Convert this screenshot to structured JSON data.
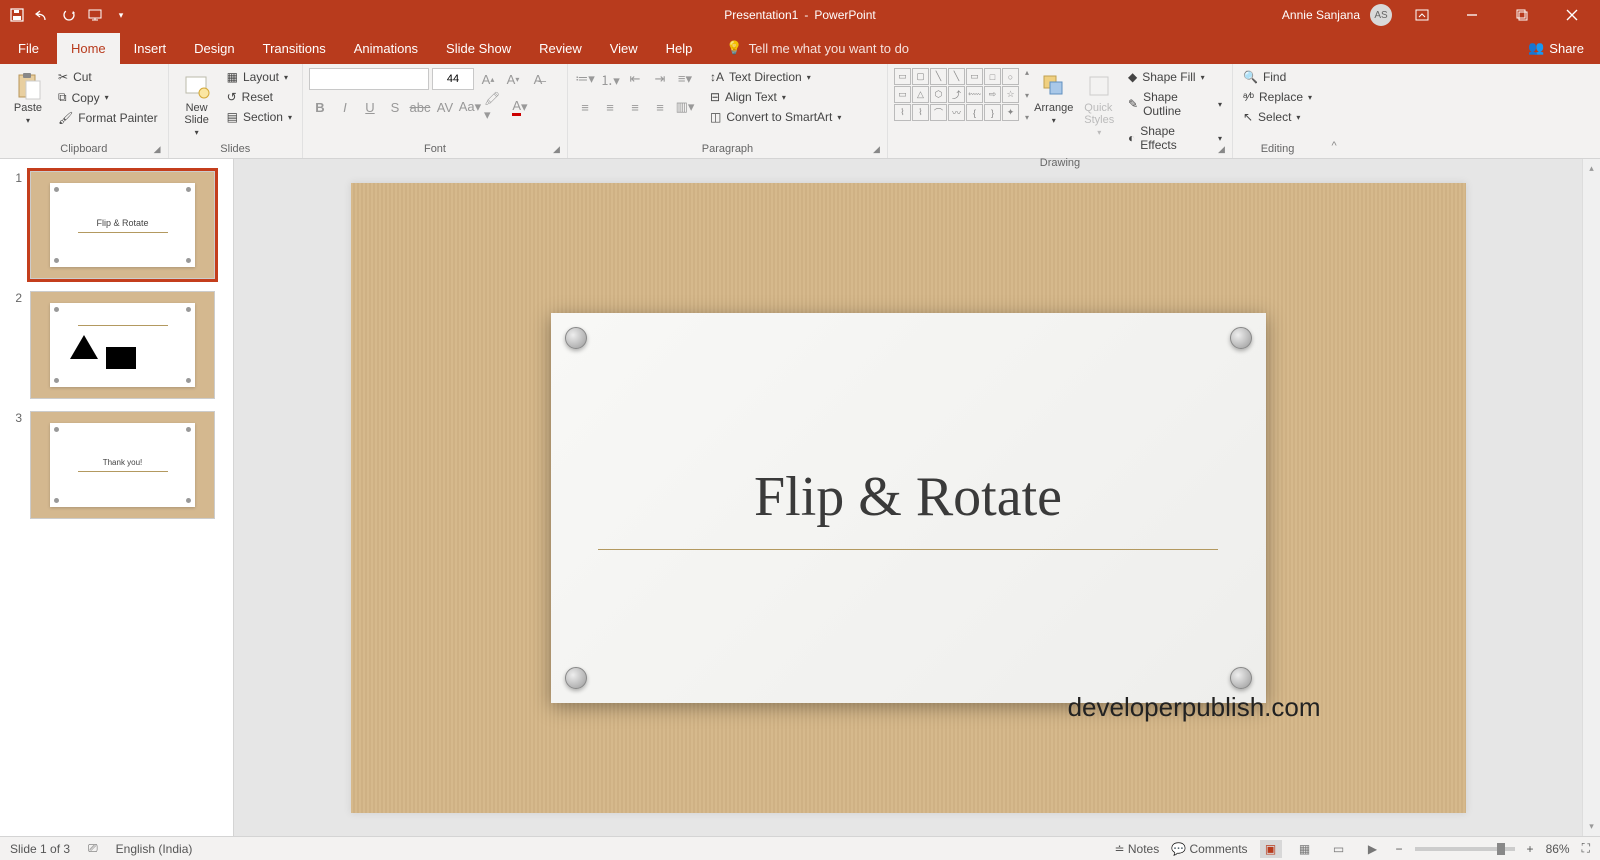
{
  "title": {
    "doc": "Presentation1",
    "app": "PowerPoint"
  },
  "user": {
    "name": "Annie Sanjana",
    "initials": "AS"
  },
  "qat": [
    "save-icon",
    "undo-icon",
    "redo-icon",
    "start-icon",
    "more-icon"
  ],
  "tabs": [
    "File",
    "Home",
    "Insert",
    "Design",
    "Transitions",
    "Animations",
    "Slide Show",
    "Review",
    "View",
    "Help"
  ],
  "active_tab": "Home",
  "tellme": "Tell me what you want to do",
  "share": "Share",
  "ribbon": {
    "clipboard": {
      "label": "Clipboard",
      "paste": "Paste",
      "cut": "Cut",
      "copy": "Copy",
      "format_painter": "Format Painter"
    },
    "slides": {
      "label": "Slides",
      "new_slide": "New\nSlide",
      "layout": "Layout",
      "reset": "Reset",
      "section": "Section"
    },
    "font": {
      "label": "Font",
      "name": "",
      "size": "44"
    },
    "paragraph": {
      "label": "Paragraph",
      "text_direction": "Text Direction",
      "align_text": "Align Text",
      "smartart": "Convert to SmartArt"
    },
    "drawing": {
      "label": "Drawing",
      "arrange": "Arrange",
      "quick_styles": "Quick\nStyles",
      "shape_fill": "Shape Fill",
      "shape_outline": "Shape Outline",
      "shape_effects": "Shape Effects"
    },
    "editing": {
      "label": "Editing",
      "find": "Find",
      "replace": "Replace",
      "select": "Select"
    }
  },
  "slides": [
    {
      "num": "1",
      "title": "Flip & Rotate",
      "active": true
    },
    {
      "num": "2",
      "title": "",
      "active": false
    },
    {
      "num": "3",
      "title": "Thank you!",
      "active": false
    }
  ],
  "main_slide": {
    "title": "Flip & Rotate"
  },
  "watermark": "developerpublish.com",
  "status": {
    "slide": "Slide 1 of 3",
    "lang": "English (India)",
    "notes": "Notes",
    "comments": "Comments",
    "zoom": "86%"
  }
}
